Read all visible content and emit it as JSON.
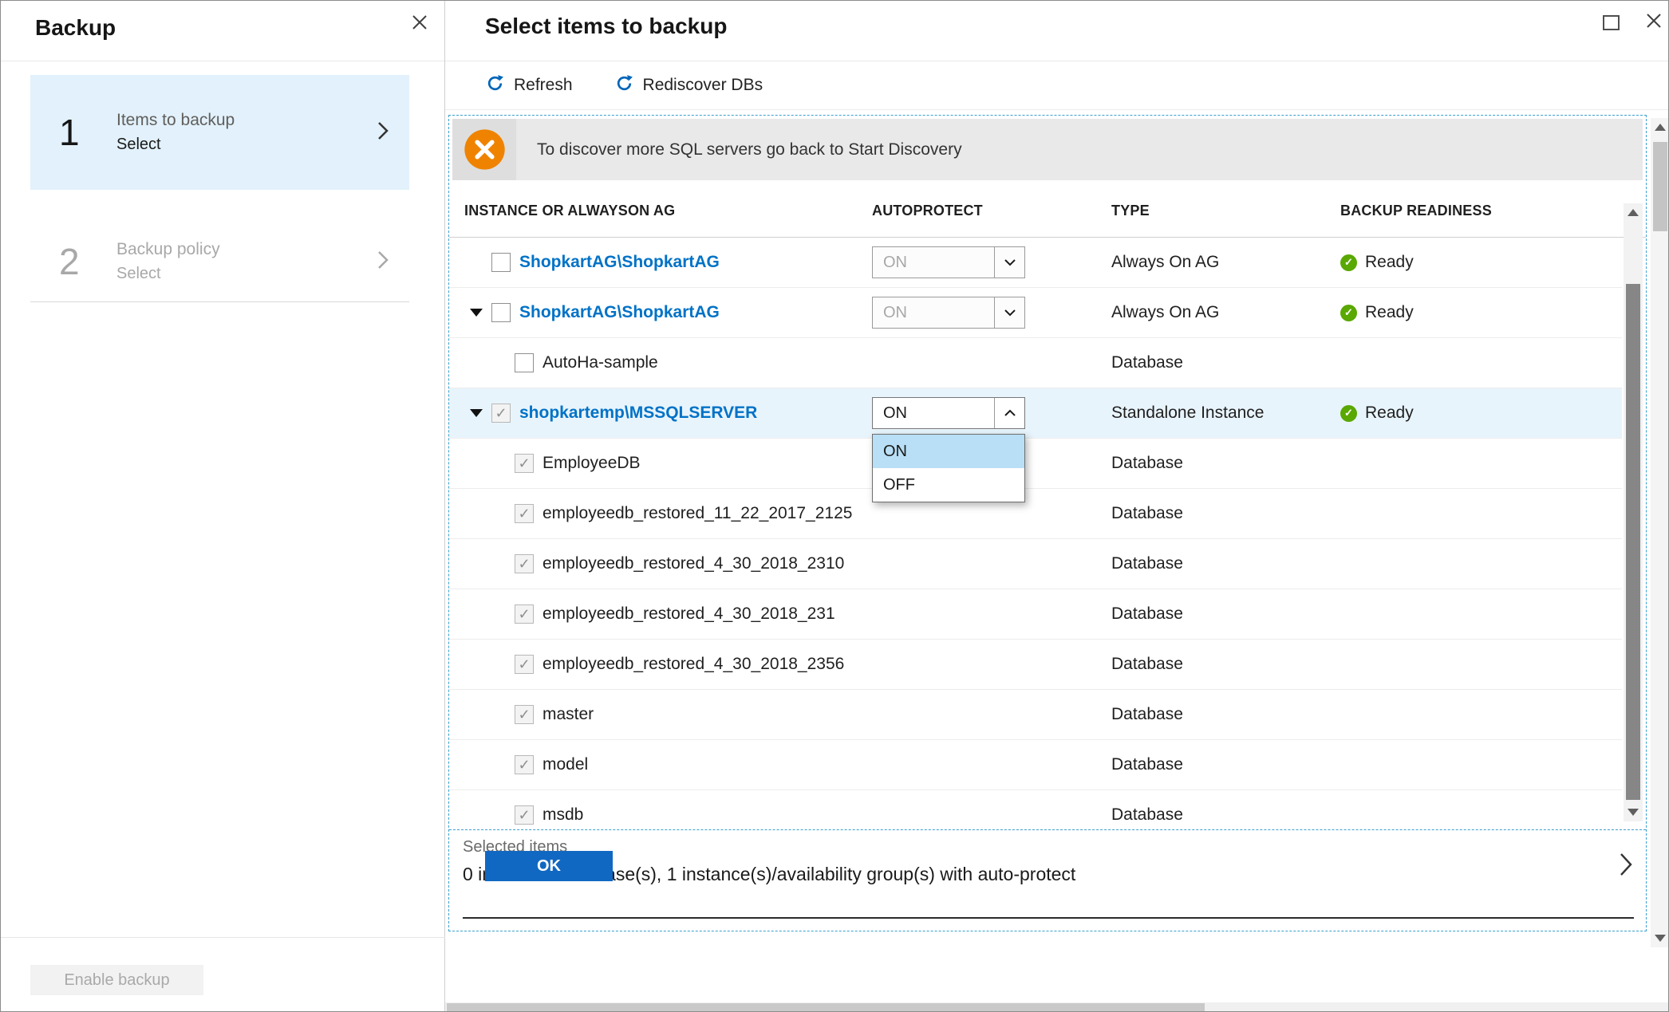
{
  "left_panel": {
    "title": "Backup",
    "steps": [
      {
        "number": "1",
        "label": "Items to backup",
        "sublabel": "Select"
      },
      {
        "number": "2",
        "label": "Backup policy",
        "sublabel": "Select"
      }
    ],
    "enable_button_label": "Enable backup"
  },
  "right_panel": {
    "title": "Select items to backup",
    "toolbar": [
      {
        "label": "Refresh"
      },
      {
        "label": "Rediscover DBs"
      }
    ],
    "banner_text": "To discover more SQL servers go back to Start Discovery",
    "table": {
      "headers": [
        "INSTANCE OR ALWAYSON AG",
        "AUTOPROTECT",
        "TYPE",
        "BACKUP READINESS"
      ],
      "rows": [
        {
          "name": "ShopkartAG\\ShopkartAG",
          "style": "link",
          "indent": 0,
          "caret": false,
          "checkbox": "unchecked",
          "autoprotect": {
            "value": "ON",
            "state": "disabled"
          },
          "type": "Always On AG",
          "readiness": "Ready",
          "highlighted": false
        },
        {
          "name": "ShopkartAG\\ShopkartAG",
          "style": "link",
          "indent": 0,
          "caret": true,
          "checkbox": "unchecked",
          "autoprotect": {
            "value": "ON",
            "state": "disabled"
          },
          "type": "Always On AG",
          "readiness": "Ready",
          "highlighted": false
        },
        {
          "name": "AutoHa-sample",
          "style": "plain",
          "indent": 1,
          "caret": false,
          "checkbox": "unchecked",
          "autoprotect": null,
          "type": "Database",
          "readiness": null,
          "highlighted": false
        },
        {
          "name": "shopkartemp\\MSSQLSERVER",
          "style": "link",
          "indent": 0,
          "caret": true,
          "checkbox": "checked",
          "autoprotect": {
            "value": "ON",
            "state": "open"
          },
          "type": "Standalone Instance",
          "readiness": "Ready",
          "highlighted": true
        },
        {
          "name": "EmployeeDB",
          "style": "plain",
          "indent": 1,
          "caret": false,
          "checkbox": "checked",
          "autoprotect": null,
          "type": "Database",
          "readiness": null,
          "highlighted": false
        },
        {
          "name": "employeedb_restored_11_22_2017_2125",
          "style": "plain",
          "indent": 1,
          "caret": false,
          "checkbox": "checked",
          "autoprotect": null,
          "type": "Database",
          "readiness": null,
          "highlighted": false
        },
        {
          "name": "employeedb_restored_4_30_2018_2310",
          "style": "plain",
          "indent": 1,
          "caret": false,
          "checkbox": "checked",
          "autoprotect": null,
          "type": "Database",
          "readiness": null,
          "highlighted": false
        },
        {
          "name": "employeedb_restored_4_30_2018_231",
          "style": "plain",
          "indent": 1,
          "caret": false,
          "checkbox": "checked",
          "autoprotect": null,
          "type": "Database",
          "readiness": null,
          "highlighted": false
        },
        {
          "name": "employeedb_restored_4_30_2018_2356",
          "style": "plain",
          "indent": 1,
          "caret": false,
          "checkbox": "checked",
          "autoprotect": null,
          "type": "Database",
          "readiness": null,
          "highlighted": false
        },
        {
          "name": "master",
          "style": "plain",
          "indent": 1,
          "caret": false,
          "checkbox": "checked",
          "autoprotect": null,
          "type": "Database",
          "readiness": null,
          "highlighted": false
        },
        {
          "name": "model",
          "style": "plain",
          "indent": 1,
          "caret": false,
          "checkbox": "checked",
          "autoprotect": null,
          "type": "Database",
          "readiness": null,
          "highlighted": false
        },
        {
          "name": "msdb",
          "style": "plain",
          "indent": 1,
          "caret": false,
          "checkbox": "checked",
          "autoprotect": null,
          "type": "Database",
          "readiness": null,
          "highlighted": false
        }
      ]
    },
    "dropdown": {
      "value": "ON",
      "options": [
        "ON",
        "OFF"
      ]
    },
    "selected_items": {
      "label": "Selected items",
      "summary": "0 individual database(s), 1 instance(s)/availability group(s) with auto-protect"
    },
    "ok_label": "OK"
  },
  "icons": {
    "refresh": "circular-arrow",
    "banner": "crossed-tools-on-orange-circle",
    "readiness": "green-check-circle"
  },
  "colors": {
    "link_blue": "#0072c6",
    "accent_blue": "#1168c2",
    "step_active_bg": "#e2f1fb",
    "dashed_border": "#3ba0cf",
    "ready_green": "#5aa802",
    "banner_orange": "#ef8300",
    "dropdown_selected_bg": "#b8dff5"
  }
}
